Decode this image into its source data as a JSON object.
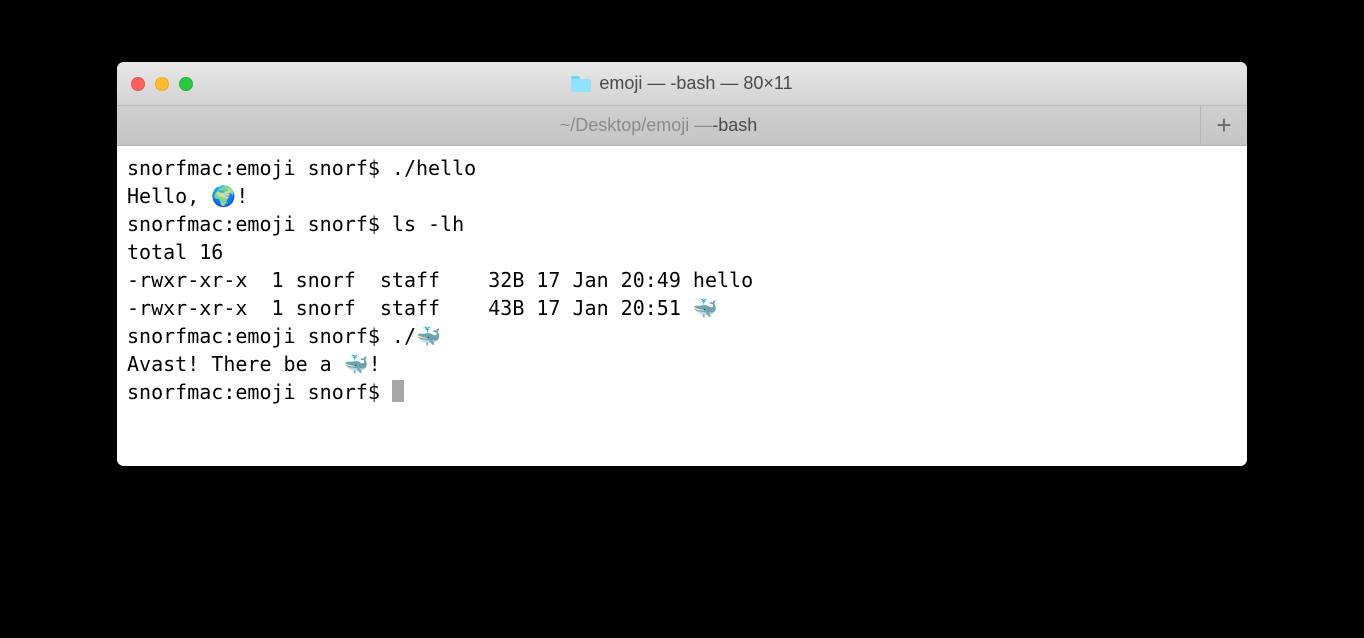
{
  "titlebar": {
    "title": "emoji — -bash — 80×11"
  },
  "tab": {
    "prefix": "~/Desktop/emoji — ",
    "name": "-bash"
  },
  "terminal": {
    "lines": [
      "snorfmac:emoji snorf$ ./hello",
      "Hello, 🌍!",
      "snorfmac:emoji snorf$ ls -lh",
      "total 16",
      "-rwxr-xr-x  1 snorf  staff    32B 17 Jan 20:49 hello",
      "-rwxr-xr-x  1 snorf  staff    43B 17 Jan 20:51 🐳",
      "snorfmac:emoji snorf$ ./🐳",
      "Avast! There be a 🐳!",
      "snorfmac:emoji snorf$ "
    ]
  }
}
